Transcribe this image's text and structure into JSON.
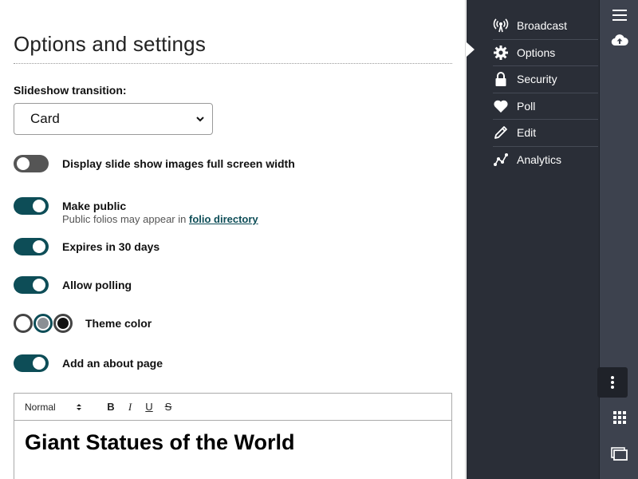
{
  "main": {
    "title": "Options and settings",
    "transition": {
      "label": "Slideshow transition:",
      "selected": "Card"
    },
    "toggles": [
      {
        "label": "Display slide show images full screen width",
        "on": false
      },
      {
        "label": "Make public",
        "sub_text": "Public folios may appear in ",
        "sub_link": "folio directory",
        "on": true
      },
      {
        "label": "Expires in 30 days",
        "on": true
      },
      {
        "label": "Allow polling",
        "on": true
      },
      {
        "label": "Add an about page",
        "on": true
      }
    ],
    "theme": {
      "label": "Theme color",
      "swatches": [
        "#ffffff",
        "#8a8f94",
        "#111111"
      ]
    },
    "editor": {
      "format": "Normal",
      "bold": "B",
      "italic": "I",
      "underline": "U",
      "strike": "S",
      "heading": "Giant Statues of the World"
    }
  },
  "sidebar": {
    "items": [
      {
        "label": "Broadcast",
        "icon": "broadcast-icon"
      },
      {
        "label": "Options",
        "icon": "gear-icon"
      },
      {
        "label": "Security",
        "icon": "lock-icon"
      },
      {
        "label": "Poll",
        "icon": "heart-icon"
      },
      {
        "label": "Edit",
        "icon": "pencil-icon"
      },
      {
        "label": "Analytics",
        "icon": "analytics-icon"
      }
    ]
  },
  "rail": {
    "icons": [
      "hamburger-menu-icon",
      "cloud-upload-icon",
      "kebab-menu-icon",
      "grid-icon",
      "windows-icon"
    ]
  },
  "colors": {
    "accent": "#0d4d57",
    "sidebar_bg": "#2a2e37",
    "rail_bg": "#3d424e"
  }
}
